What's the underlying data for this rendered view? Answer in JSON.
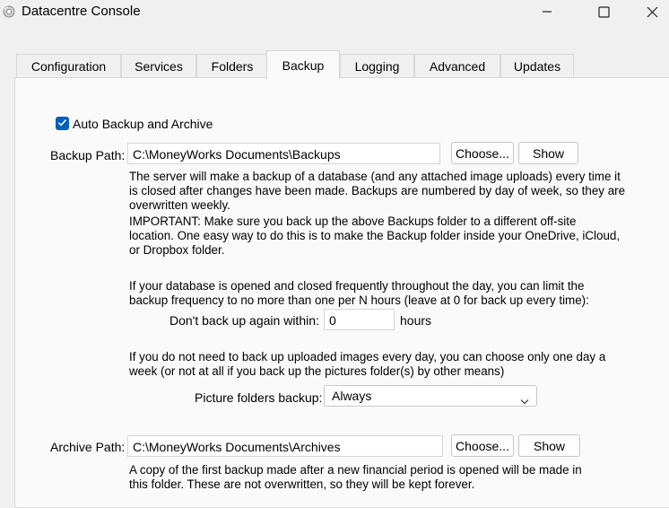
{
  "window": {
    "title": "Datacentre Console",
    "icon": "disc-icon",
    "controls": [
      "minimize-icon",
      "maximize-icon",
      "close-icon"
    ]
  },
  "tabs": [
    {
      "label": "Configuration"
    },
    {
      "label": "Services"
    },
    {
      "label": "Folders"
    },
    {
      "label": "Backup",
      "active": true
    },
    {
      "label": "Logging"
    },
    {
      "label": "Advanced"
    },
    {
      "label": "Updates"
    }
  ],
  "backup": {
    "auto_label": "Auto Backup and Archive",
    "auto_checked": true,
    "path_label": "Backup Path:",
    "path_value": "C:\\MoneyWorks Documents\\Backups",
    "choose_label": "Choose...",
    "show_label": "Show",
    "desc1": [
      "The server will make a backup of a database (and any attached image uploads) every time it",
      "is closed after changes have been made. Backups are numbered by day of week, so they are",
      "overwritten weekly."
    ],
    "desc2": [
      "IMPORTANT: Make sure you back up the above Backups folder to a different off-site",
      "location. One easy way to do this is to make the Backup folder inside your OneDrive, iCloud,",
      "or Dropbox folder."
    ],
    "desc3": [
      "If your database is opened and closed frequently throughout the day, you can limit the",
      "backup frequency to no more than one per N hours (leave at 0 for back up every time):"
    ],
    "interval_label": "Don't back up again within:",
    "interval_value": "0",
    "interval_unit": "hours",
    "desc4": [
      "If you do not need to back up uploaded images every day, you can choose only one day a",
      "week (or not at all if you back up the pictures folder(s) by other means)"
    ],
    "picture_label": "Picture folders backup:",
    "picture_value": "Always"
  },
  "archive": {
    "path_label": "Archive Path:",
    "path_value": "C:\\MoneyWorks Documents\\Archives",
    "choose_label": "Choose...",
    "show_label": "Show",
    "desc": [
      "A copy of the first backup made after a new financial period is opened will be made in",
      "this folder. These are not overwritten, so they will be kept forever."
    ]
  },
  "colors": {
    "accent": "#005fb8",
    "window_bg": "#f0f0f0",
    "panel_bg": "#fafafa",
    "border": "#d8d8d8"
  }
}
